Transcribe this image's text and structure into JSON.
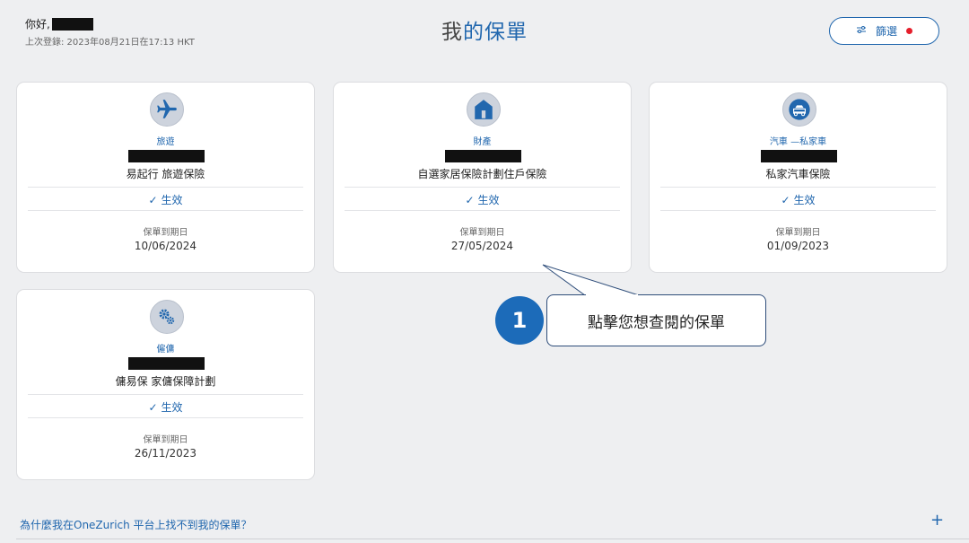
{
  "header": {
    "greeting": "你好,",
    "last_login": "上次登錄: 2023年08月21日在17:13 HKT",
    "title_prefix": "我",
    "title_accent": "的保單",
    "filter_label": "篩選"
  },
  "policies": [
    {
      "category": "旅遊",
      "product": "易起行 旅遊保險",
      "status": "生效",
      "expiry_label": "保單到期日",
      "expiry_date": "10/06/2024",
      "icon": "airplane-icon"
    },
    {
      "category": "財產",
      "product": "自選家居保險計劃住戶保險",
      "status": "生效",
      "expiry_label": "保單到期日",
      "expiry_date": "27/05/2024",
      "icon": "house-icon"
    },
    {
      "category": "汽車 —私家車",
      "product": "私家汽車保險",
      "status": "生效",
      "expiry_label": "保單到期日",
      "expiry_date": "01/09/2023",
      "icon": "car-icon"
    },
    {
      "category": "僱傭",
      "product": "傭易保 家傭保障計劃",
      "status": "生效",
      "expiry_label": "保單到期日",
      "expiry_date": "26/11/2023",
      "icon": "gears-icon"
    }
  ],
  "callout": {
    "step": "1",
    "text": "點擊您想查閱的保單"
  },
  "footer": {
    "faq": "為什麼我在OneZurich 平台上找不到我的保單？",
    "expand": "+"
  },
  "colors": {
    "accent": "#2167ae",
    "badge": "#1c6bb9",
    "notification": "#e51e2b"
  }
}
